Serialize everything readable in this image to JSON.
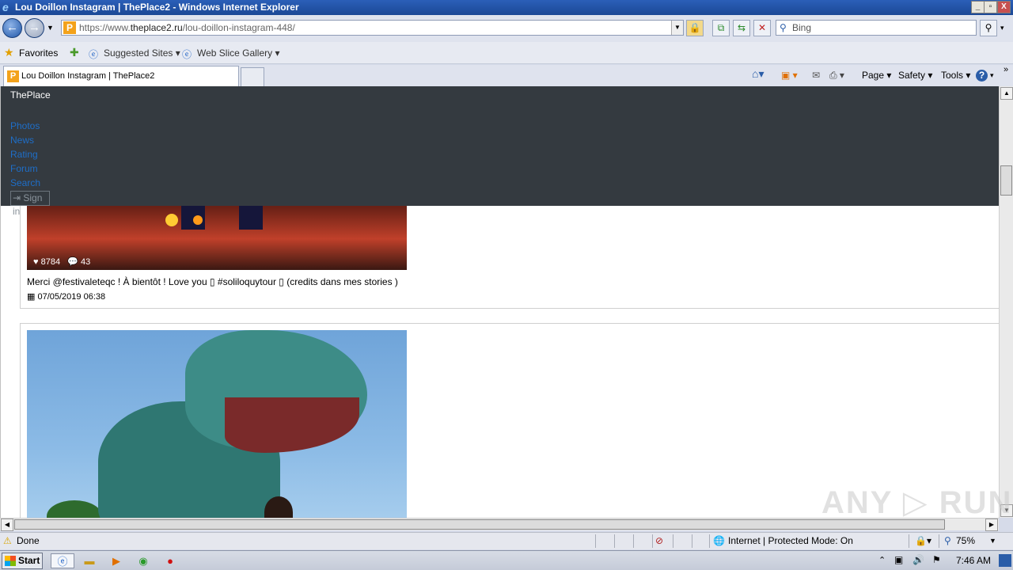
{
  "window": {
    "title": "Lou Doillon Instagram | ThePlace2 - Windows Internet Explorer",
    "minimize": "_",
    "maximize": "▫",
    "close": "X"
  },
  "navbar": {
    "back_icon": "back-arrow-icon",
    "forward_icon": "forward-arrow-icon",
    "favicon_letter": "P",
    "url_prefix": "https://www.",
    "url_domain": "theplace2.ru",
    "url_path": "/lou-doillon-instagram-448/",
    "search_placeholder": "Bing"
  },
  "favorites_bar": {
    "favorites_label": "Favorites",
    "suggested_sites": "Suggested Sites ▾",
    "web_slice_gallery": "Web Slice Gallery ▾"
  },
  "tabs": {
    "active_tab_title": "Lou Doillon Instagram | ThePlace2",
    "favicon_letter": "P"
  },
  "command_bar": {
    "page": "Page ▾",
    "safety": "Safety ▾",
    "tools": "Tools ▾",
    "help": "?"
  },
  "site_nav": {
    "brand": "ThePlace",
    "links": [
      "Photos",
      "News",
      "Rating",
      "Forum",
      "Search"
    ],
    "sign_in": "⇥ Sign in"
  },
  "posts": [
    {
      "likes": "8784",
      "comments": "43",
      "caption": "Merci @festivaleteqc ! À bientôt ! Love you ▯ #soliloquytour ▯ (credits dans mes stories )",
      "date": "07/05/2019 06:38"
    }
  ],
  "status_bar": {
    "status": "Done",
    "zone": "Internet | Protected Mode: On",
    "zoom": "75%"
  },
  "taskbar": {
    "start": "Start",
    "clock": "7:46 AM"
  },
  "watermark": "ANY ▷ RUN"
}
